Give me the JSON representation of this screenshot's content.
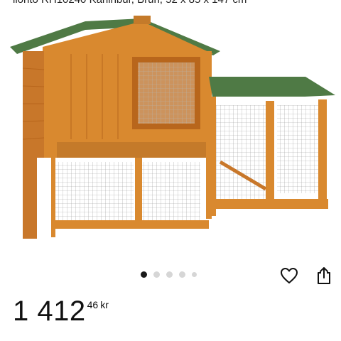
{
  "product": {
    "title": "lionto RH10240 Kaninbur, Brun, 52 x 85 x 147 cm",
    "price_whole": "1 412",
    "price_cents": "46",
    "currency": "kr"
  },
  "gallery": {
    "image_count": 5,
    "active_index": 0
  },
  "icons": {
    "favorite": "heart-icon",
    "share": "share-icon"
  },
  "colors": {
    "wood": "#d9892f",
    "wood_dark": "#b8661c",
    "roof": "#4f7a45",
    "active_dot": "#1a1a1a",
    "inactive_dot": "#d6d6d6"
  }
}
